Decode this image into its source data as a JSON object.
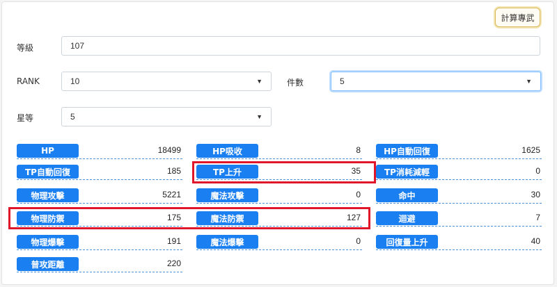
{
  "toolbar": {
    "calc_label": "計算專武"
  },
  "form": {
    "level_label": "等級",
    "level_value": "107",
    "rank_label": "RANK",
    "rank_value": "10",
    "equip_label": "件數",
    "equip_value": "5",
    "star_label": "星等",
    "star_value": "5"
  },
  "stats": [
    {
      "label": "HP",
      "value": "18499"
    },
    {
      "label": "HP吸收",
      "value": "8"
    },
    {
      "label": "HP自動回復",
      "value": "1625"
    },
    {
      "label": "TP自動回復",
      "value": "185"
    },
    {
      "label": "TP上升",
      "value": "35"
    },
    {
      "label": "TP消耗減輕",
      "value": "0"
    },
    {
      "label": "物理攻擊",
      "value": "5221"
    },
    {
      "label": "魔法攻擊",
      "value": "0"
    },
    {
      "label": "命中",
      "value": "30"
    },
    {
      "label": "物理防禦",
      "value": "175"
    },
    {
      "label": "魔法防禦",
      "value": "127"
    },
    {
      "label": "迴避",
      "value": "7"
    },
    {
      "label": "物理爆擊",
      "value": "191"
    },
    {
      "label": "魔法爆擊",
      "value": "0"
    },
    {
      "label": "回復量上升",
      "value": "40"
    },
    {
      "label": "普攻距離",
      "value": "220"
    }
  ]
}
